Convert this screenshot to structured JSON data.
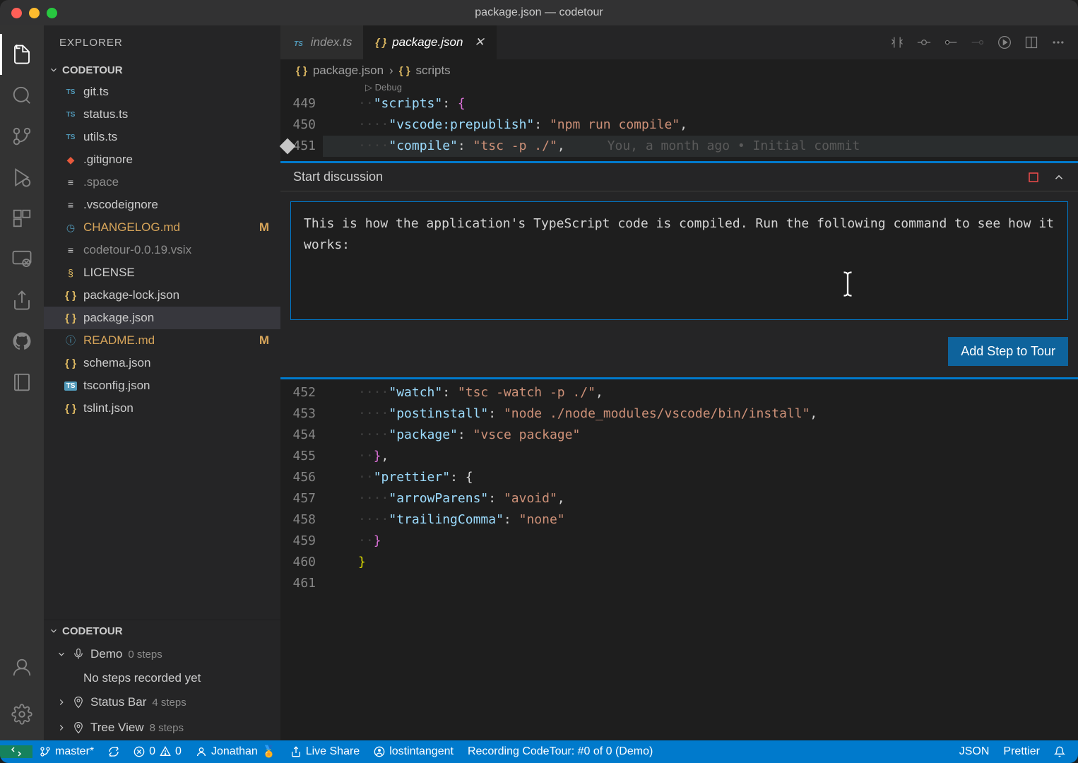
{
  "titlebar": {
    "title": "package.json — codetour"
  },
  "sidebar": {
    "title": "EXPLORER",
    "panelTitle": "CODETOUR",
    "files": [
      {
        "icon": "ts",
        "name": "git.ts",
        "mod": false,
        "dim": false
      },
      {
        "icon": "ts",
        "name": "status.ts",
        "mod": false,
        "dim": false
      },
      {
        "icon": "ts",
        "name": "utils.ts",
        "mod": false,
        "dim": false
      },
      {
        "icon": "git",
        "name": ".gitignore",
        "mod": false,
        "dim": false
      },
      {
        "icon": "lines",
        "name": ".space",
        "mod": false,
        "dim": true
      },
      {
        "icon": "lines",
        "name": ".vscodeignore",
        "mod": false,
        "dim": false
      },
      {
        "icon": "clock",
        "name": "CHANGELOG.md",
        "mod": true,
        "dim": false
      },
      {
        "icon": "lines",
        "name": "codetour-0.0.19.vsix",
        "mod": false,
        "dim": true
      },
      {
        "icon": "cert",
        "name": "LICENSE",
        "mod": false,
        "dim": false
      },
      {
        "icon": "json",
        "name": "package-lock.json",
        "mod": false,
        "dim": false
      },
      {
        "icon": "json",
        "name": "package.json",
        "mod": false,
        "dim": false,
        "active": true
      },
      {
        "icon": "info",
        "name": "README.md",
        "mod": true,
        "dim": false
      },
      {
        "icon": "json",
        "name": "schema.json",
        "mod": false,
        "dim": false
      },
      {
        "icon": "tsc",
        "name": "tsconfig.json",
        "mod": false,
        "dim": false
      },
      {
        "icon": "json",
        "name": "tslint.json",
        "mod": false,
        "dim": false
      }
    ],
    "modifiedBadge": "M",
    "codetourTitle": "CODETOUR",
    "tours": [
      {
        "name": "Demo",
        "count": "0 steps",
        "expanded": true,
        "sub": "No steps recorded yet",
        "icon": "mic"
      },
      {
        "name": "Status Bar",
        "count": "4 steps",
        "expanded": false,
        "icon": "map"
      },
      {
        "name": "Tree View",
        "count": "8 steps",
        "expanded": false,
        "icon": "map"
      }
    ]
  },
  "tabs": [
    {
      "icon": "ts",
      "label": "index.ts",
      "active": false
    },
    {
      "icon": "json",
      "label": "package.json",
      "active": true,
      "close": true
    }
  ],
  "breadcrumb": {
    "parts": [
      "package.json",
      "scripts"
    ]
  },
  "editor": {
    "debugLabel": "Debug",
    "topLines": [
      {
        "n": 449,
        "segments": [
          {
            "t": "dot",
            "v": "··"
          },
          {
            "t": "key",
            "v": "\"scripts\""
          },
          {
            "t": "punc",
            "v": ": "
          },
          {
            "t": "bracep",
            "v": "{"
          }
        ]
      },
      {
        "n": 450,
        "segments": [
          {
            "t": "dot",
            "v": "····"
          },
          {
            "t": "key",
            "v": "\"vscode:prepublish\""
          },
          {
            "t": "punc",
            "v": ": "
          },
          {
            "t": "str",
            "v": "\"npm run compile\""
          },
          {
            "t": "punc",
            "v": ","
          }
        ]
      },
      {
        "n": 451,
        "segments": [
          {
            "t": "dot",
            "v": "····"
          },
          {
            "t": "key",
            "v": "\"compile\""
          },
          {
            "t": "punc",
            "v": ": "
          },
          {
            "t": "str",
            "v": "\"tsc -p ./\""
          },
          {
            "t": "punc",
            "v": ","
          }
        ],
        "blame": "You, a month ago • Initial commit",
        "highlight": true,
        "diamond": true
      }
    ],
    "bottomLines": [
      {
        "n": 452,
        "segments": [
          {
            "t": "dot",
            "v": "····"
          },
          {
            "t": "key",
            "v": "\"watch\""
          },
          {
            "t": "punc",
            "v": ": "
          },
          {
            "t": "str",
            "v": "\"tsc -watch -p ./\""
          },
          {
            "t": "punc",
            "v": ","
          }
        ]
      },
      {
        "n": 453,
        "segments": [
          {
            "t": "dot",
            "v": "····"
          },
          {
            "t": "key",
            "v": "\"postinstall\""
          },
          {
            "t": "punc",
            "v": ": "
          },
          {
            "t": "str",
            "v": "\"node ./node_modules/vscode/bin/install\""
          },
          {
            "t": "punc",
            "v": ","
          }
        ]
      },
      {
        "n": 454,
        "segments": [
          {
            "t": "dot",
            "v": "····"
          },
          {
            "t": "key",
            "v": "\"package\""
          },
          {
            "t": "punc",
            "v": ": "
          },
          {
            "t": "str",
            "v": "\"vsce package\""
          }
        ]
      },
      {
        "n": 455,
        "segments": [
          {
            "t": "dot",
            "v": "··"
          },
          {
            "t": "bracep",
            "v": "}"
          },
          {
            "t": "punc",
            "v": ","
          }
        ]
      },
      {
        "n": 456,
        "segments": [
          {
            "t": "dot",
            "v": "··"
          },
          {
            "t": "key",
            "v": "\"prettier\""
          },
          {
            "t": "punc",
            "v": ": {"
          }
        ]
      },
      {
        "n": 457,
        "segments": [
          {
            "t": "dot",
            "v": "····"
          },
          {
            "t": "key",
            "v": "\"arrowParens\""
          },
          {
            "t": "punc",
            "v": ": "
          },
          {
            "t": "str",
            "v": "\"avoid\""
          },
          {
            "t": "punc",
            "v": ","
          }
        ]
      },
      {
        "n": 458,
        "segments": [
          {
            "t": "dot",
            "v": "····"
          },
          {
            "t": "key",
            "v": "\"trailingComma\""
          },
          {
            "t": "punc",
            "v": ": "
          },
          {
            "t": "str",
            "v": "\"none\""
          }
        ]
      },
      {
        "n": 459,
        "segments": [
          {
            "t": "dot",
            "v": "··"
          },
          {
            "t": "bracep",
            "v": "}"
          }
        ]
      },
      {
        "n": 460,
        "segments": [
          {
            "t": "brace",
            "v": "}"
          }
        ]
      },
      {
        "n": 461,
        "segments": []
      }
    ]
  },
  "discussion": {
    "title": "Start discussion",
    "text": "This is how the application's TypeScript code is compiled. Run the following command to see how it works:",
    "button": "Add Step to Tour"
  },
  "statusbar": {
    "branch": "master*",
    "errors": "0",
    "warnings": "0",
    "user": "Jonathan",
    "liveshare": "Live Share",
    "account": "lostintangent",
    "recording": "Recording CodeTour: #0 of 0 (Demo)",
    "lang": "JSON",
    "formatter": "Prettier"
  }
}
